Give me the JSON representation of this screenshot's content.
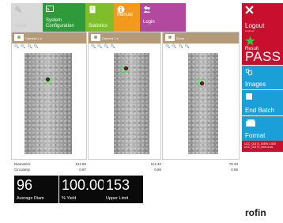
{
  "top_menu": {
    "setup": {
      "label": "Setup",
      "icon": "gear-icon"
    },
    "system_configuration": {
      "label": "System Configuration",
      "icon": "monitor-icon"
    },
    "statistics": {
      "label": "Statistics",
      "icon": "document-icon"
    },
    "manual": {
      "label": "Manual",
      "icon": "info-icon"
    },
    "login": {
      "label": "Login",
      "icon": "users-icon"
    }
  },
  "side_menu": {
    "logout": {
      "label": "Logout",
      "sub": "engineer",
      "icon": "close-icon"
    },
    "result": {
      "small": "Result",
      "value": "PASS",
      "icon": "star-icon"
    },
    "images": {
      "label": "Images",
      "icon": "images-icon"
    },
    "end_batch": {
      "label": "End Batch",
      "icon": "stop-icon"
    },
    "format": {
      "label": "Format",
      "icon": "folder-icon"
    },
    "info_lines": [
      "UCC_00174_INEW 4.530",
      "UCC_00174_med.4.ws"
    ]
  },
  "cameras": [
    {
      "name": "Camera 1 a",
      "tools": [
        "🔍",
        "🔍",
        "🔍",
        "🔍"
      ]
    },
    {
      "name": "Camera 1 b",
      "tools": [
        "🔍",
        "🔍",
        "🔍",
        "🔍"
      ]
    },
    {
      "name": "Zoom",
      "tools": [
        "🔍",
        "🔍",
        "🔍",
        "🔍"
      ]
    }
  ],
  "measurements": {
    "labels": [
      "Diameters",
      "Circularity"
    ],
    "values": [
      [
        "124.80",
        "0.87"
      ],
      [
        "114.40",
        "0.86"
      ],
      [
        "78.20",
        "0.85"
      ]
    ]
  },
  "kpis": [
    {
      "value": "96",
      "label": "Average Diam"
    },
    {
      "value": "100.00",
      "label": "% Yield"
    },
    {
      "value": "153",
      "label": "Upper Limit"
    }
  ],
  "brand": "rofin",
  "colors": {
    "system_configuration": "#2f9a3a",
    "statistics": "#7fbe2b",
    "manual": "#f29a1e",
    "login": "#b14a9e",
    "logout": "#c8102e",
    "images": "#1a9fd8",
    "panel_header": "#b49a78"
  }
}
